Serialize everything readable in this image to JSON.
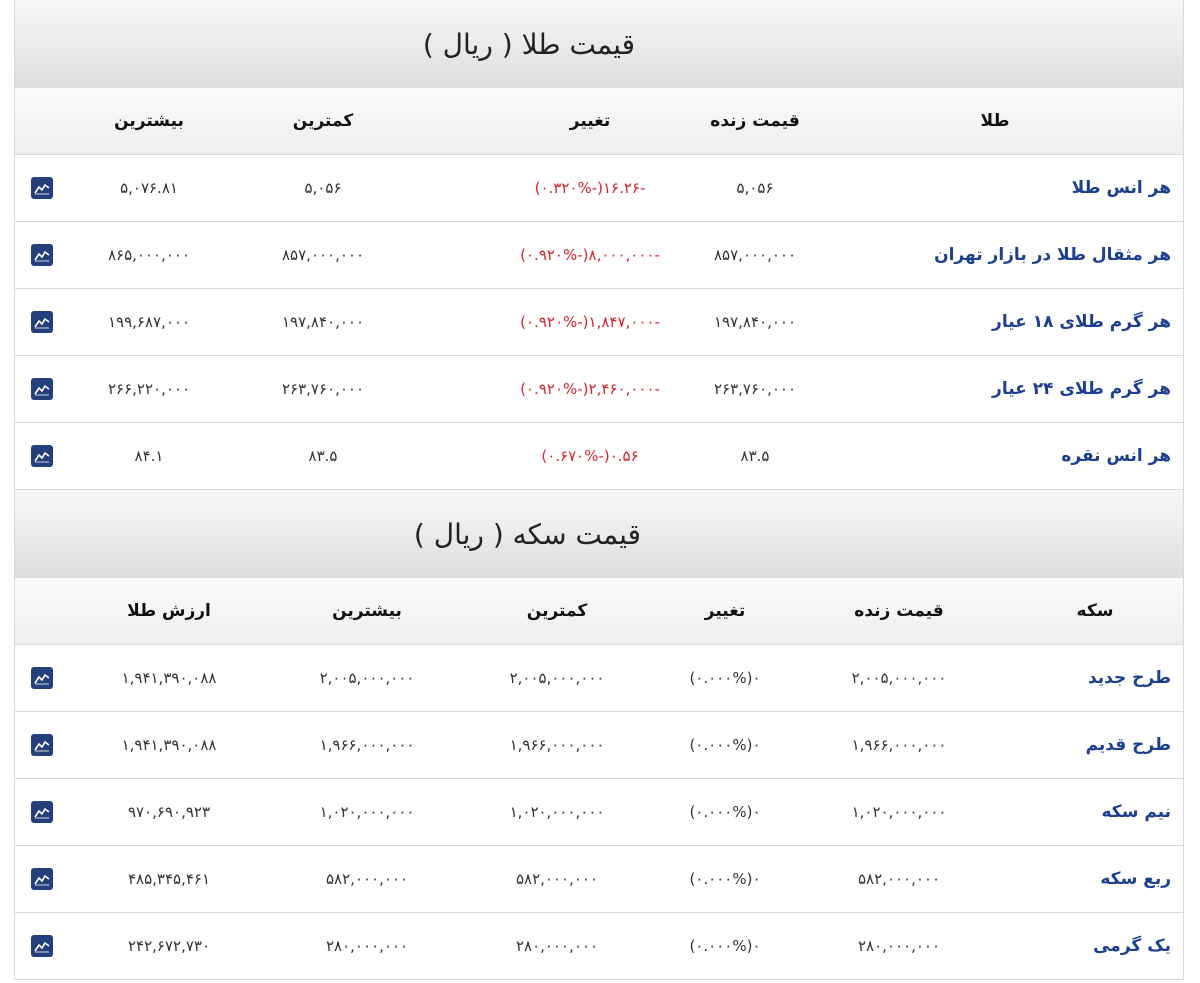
{
  "gold": {
    "title": "قیمت طلا ( ریال )",
    "headers": {
      "name": "طلا",
      "live": "قیمت زنده",
      "change": "تغییر",
      "min": "کمترین",
      "max": "بیشترین"
    },
    "rows": [
      {
        "name": "هر انس طلا",
        "live": "۵,۰۵۶",
        "change": "-۱۶.۲۶(-۰.۳۲۰%)",
        "min": "۵,۰۵۶",
        "max": "۵,۰۷۶.۸۱"
      },
      {
        "name": "هر مثقال طلا در بازار تهران",
        "live": "۸۵۷,۰۰۰,۰۰۰",
        "change": "-۸,۰۰۰,۰۰۰(-۰.۹۲۰%)",
        "min": "۸۵۷,۰۰۰,۰۰۰",
        "max": "۸۶۵,۰۰۰,۰۰۰"
      },
      {
        "name": "هر گرم طلای ۱۸ عیار",
        "live": "۱۹۷,۸۴۰,۰۰۰",
        "change": "-۱,۸۴۷,۰۰۰(-۰.۹۲۰%)",
        "min": "۱۹۷,۸۴۰,۰۰۰",
        "max": "۱۹۹,۶۸۷,۰۰۰"
      },
      {
        "name": "هر گرم طلای ۲۴ عیار",
        "live": "۲۶۳,۷۶۰,۰۰۰",
        "change": "-۲,۴۶۰,۰۰۰(-۰.۹۲۰%)",
        "min": "۲۶۳,۷۶۰,۰۰۰",
        "max": "۲۶۶,۲۲۰,۰۰۰"
      },
      {
        "name": "هر انس نقره",
        "live": "۸۳.۵",
        "change": "۰.۵۶(-۰.۶۷۰%)",
        "min": "۸۳.۵",
        "max": "۸۴.۱"
      }
    ]
  },
  "coin": {
    "title": "قیمت سکه ( ریال )",
    "headers": {
      "name": "سکه",
      "live": "قیمت زنده",
      "change": "تغییر",
      "min": "کمترین",
      "max": "بیشترین",
      "value": "ارزش طلا"
    },
    "rows": [
      {
        "name": "طرح جدید",
        "live": "۲,۰۰۵,۰۰۰,۰۰۰",
        "change": "۰(۰.۰۰۰%)",
        "min": "۲,۰۰۵,۰۰۰,۰۰۰",
        "max": "۲,۰۰۵,۰۰۰,۰۰۰",
        "value": "۱,۹۴۱,۳۹۰,۰۸۸"
      },
      {
        "name": "طرح قدیم",
        "live": "۱,۹۶۶,۰۰۰,۰۰۰",
        "change": "۰(۰.۰۰۰%)",
        "min": "۱,۹۶۶,۰۰۰,۰۰۰",
        "max": "۱,۹۶۶,۰۰۰,۰۰۰",
        "value": "۱,۹۴۱,۳۹۰,۰۸۸"
      },
      {
        "name": "نیم سکه",
        "live": "۱,۰۲۰,۰۰۰,۰۰۰",
        "change": "۰(۰.۰۰۰%)",
        "min": "۱,۰۲۰,۰۰۰,۰۰۰",
        "max": "۱,۰۲۰,۰۰۰,۰۰۰",
        "value": "۹۷۰,۶۹۰,۹۲۳"
      },
      {
        "name": "ربع سکه",
        "live": "۵۸۲,۰۰۰,۰۰۰",
        "change": "۰(۰.۰۰۰%)",
        "min": "۵۸۲,۰۰۰,۰۰۰",
        "max": "۵۸۲,۰۰۰,۰۰۰",
        "value": "۴۸۵,۳۴۵,۴۶۱"
      },
      {
        "name": "یک گرمی",
        "live": "۲۸۰,۰۰۰,۰۰۰",
        "change": "۰(۰.۰۰۰%)",
        "min": "۲۸۰,۰۰۰,۰۰۰",
        "max": "۲۸۰,۰۰۰,۰۰۰",
        "value": "۲۴۲,۶۷۲,۷۳۰"
      }
    ]
  },
  "icons": {
    "row_action": "chart-icon"
  },
  "colors": {
    "name_text": "#1d3f8f",
    "negative": "#d9232d",
    "icon_bg": "#243f7a"
  }
}
